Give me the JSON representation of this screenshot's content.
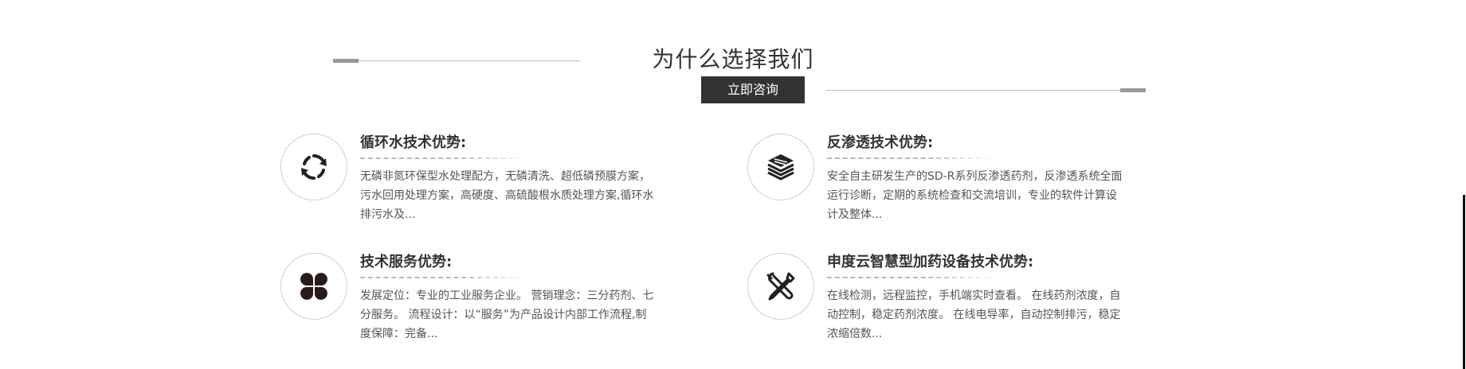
{
  "section": {
    "title": "为什么选择我们",
    "consult_label": "立即咨询"
  },
  "cards": [
    {
      "title": "循环水技术优势:",
      "icon": "refresh-cycle-icon",
      "desc_lines": [
        "无磷非氮环保型水处理配方，无磷清洗、超低磷预膜方案，",
        "污水回用处理方案，高硬度、高硫酸根水质处理方案,循环水",
        "排污水及..."
      ]
    },
    {
      "title": "反渗透技术优势:",
      "icon": "layered-membrane-icon",
      "desc_lines": [
        "安全自主研发生产的SD-R系列反渗透药剂，反渗透系统全面",
        "运行诊断，定期的系统检查和交流培训，专业的软件计算设",
        "计及整体..."
      ]
    },
    {
      "title": "技术服务优势:",
      "icon": "four-petal-icon",
      "desc_lines": [
        "发展定位：专业的工业服务企业。 营销理念：三分药剂、七",
        "分服务。 流程设计：以“服务”为产品设计内部工作流程,制",
        "度保障：完备..."
      ]
    },
    {
      "title": "申度云智慧型加药设备技术优势:",
      "icon": "wrench-screwdriver-icon",
      "desc_lines": [
        "在线检测，远程监控，手机端实时查看。 在线药剂浓度，自",
        "动控制，稳定药剂浓度。 在线电导率，自动控制排污，稳定",
        "浓缩倍数..."
      ]
    }
  ],
  "colors": {
    "button_bg": "#333333",
    "title": "#333333",
    "text": "#555555",
    "divider": "#bbbbbb"
  }
}
